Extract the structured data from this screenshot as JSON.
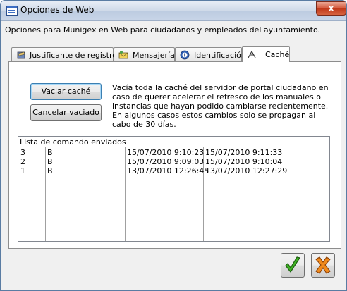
{
  "window": {
    "title": "Opciones de Web",
    "close_glyph": "x"
  },
  "subtitle": "Opciones para Munigex en Web para ciudadanos y empleados del ayuntamiento.",
  "tabs": [
    {
      "label": "Justificante de registro",
      "icon": "registry-icon"
    },
    {
      "label": "Mensajería",
      "icon": "messaging-icon"
    },
    {
      "label": "Identificación",
      "icon": "identification-icon"
    },
    {
      "label": "Caché",
      "icon": "cache-icon",
      "active": true
    }
  ],
  "cache": {
    "clear_button": "Vaciar caché",
    "cancel_button": "Cancelar vaciado",
    "description": "Vacía toda la caché del servidor de portal ciudadano en caso de querer acelerar el refresco de los manuales o instancias que hayan podido cambiarse recientemente. En algunos casos estos cambios solo se propagan al cabo de 30 días."
  },
  "command_list": {
    "header": "Lista de comando enviados",
    "rows": [
      [
        "3",
        "B",
        "15/07/2010 9:10:23",
        "15/07/2010 9:11:33"
      ],
      [
        "2",
        "B",
        "15/07/2010 9:09:03",
        "15/07/2010 9:10:04"
      ],
      [
        "1",
        "B",
        "13/07/2010 12:26:45",
        "13/07/2010 12:27:29"
      ]
    ]
  },
  "buttons": {
    "ok_icon": "checkmark-icon",
    "cancel_icon": "cancel-icon"
  },
  "colors": {
    "accent": "#3c6ec4",
    "close": "#c0391b",
    "ok": "#2e9a1b",
    "cancel": "#e87a12"
  }
}
